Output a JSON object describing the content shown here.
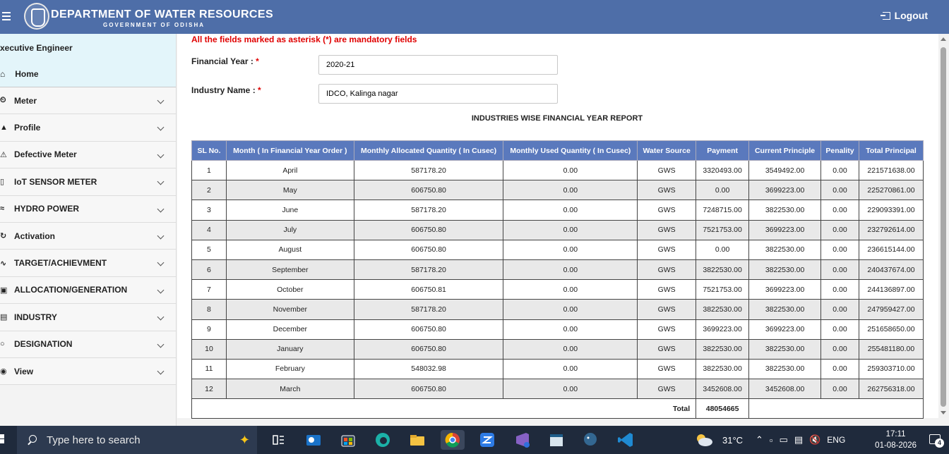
{
  "header": {
    "title": "DEPARTMENT OF WATER RESOURCES",
    "subtitle": "GOVERNMENT OF ODISHA",
    "logout_label": "Logout"
  },
  "sidebar": {
    "role": "xecutive Engineer",
    "home_label": "Home",
    "items": [
      {
        "label": "Meter",
        "icon": "gauge-icon"
      },
      {
        "label": "Profile",
        "icon": "user-icon"
      },
      {
        "label": "Defective Meter",
        "icon": "warning-icon"
      },
      {
        "label": "IoT SENSOR METER",
        "icon": "sensor-icon"
      },
      {
        "label": "HYDRO POWER",
        "icon": "water-icon"
      },
      {
        "label": "Activation",
        "icon": "refresh-icon"
      },
      {
        "label": "TARGET/ACHIEVMENT",
        "icon": "trend-icon"
      },
      {
        "label": "ALLOCATION/GENERATION",
        "icon": "allocation-icon"
      },
      {
        "label": "INDUSTRY",
        "icon": "industry-icon"
      },
      {
        "label": "DESIGNATION",
        "icon": "person-icon"
      },
      {
        "label": "View",
        "icon": "eye-icon"
      }
    ]
  },
  "form": {
    "mandatory_note": "All the fields marked as asterisk (*) are mandatory fields",
    "financial_year_label": "Financial Year :",
    "financial_year_value": "2020-21",
    "industry_label": "Industry Name :",
    "industry_value": "IDCO, Kalinga nagar",
    "asterisk": "*"
  },
  "report": {
    "title": "INDUSTRIES WISE FINANCIAL YEAR REPORT",
    "columns": [
      "SL No.",
      "Month ( In Financial Year Order )",
      "Monthly Allocated Quantity ( In Cusec)",
      "Monthly Used Quantity ( In Cusec)",
      "Water Source",
      "Payment",
      "Current Principle",
      "Penality",
      "Total Principal"
    ],
    "rows": [
      [
        "1",
        "April",
        "587178.20",
        "0.00",
        "GWS",
        "3320493.00",
        "3549492.00",
        "0.00",
        "221571638.00"
      ],
      [
        "2",
        "May",
        "606750.80",
        "0.00",
        "GWS",
        "0.00",
        "3699223.00",
        "0.00",
        "225270861.00"
      ],
      [
        "3",
        "June",
        "587178.20",
        "0.00",
        "GWS",
        "7248715.00",
        "3822530.00",
        "0.00",
        "229093391.00"
      ],
      [
        "4",
        "July",
        "606750.80",
        "0.00",
        "GWS",
        "7521753.00",
        "3699223.00",
        "0.00",
        "232792614.00"
      ],
      [
        "5",
        "August",
        "606750.80",
        "0.00",
        "GWS",
        "0.00",
        "3822530.00",
        "0.00",
        "236615144.00"
      ],
      [
        "6",
        "September",
        "587178.20",
        "0.00",
        "GWS",
        "3822530.00",
        "3822530.00",
        "0.00",
        "240437674.00"
      ],
      [
        "7",
        "October",
        "606750.81",
        "0.00",
        "GWS",
        "7521753.00",
        "3699223.00",
        "0.00",
        "244136897.00"
      ],
      [
        "8",
        "November",
        "587178.20",
        "0.00",
        "GWS",
        "3822530.00",
        "3822530.00",
        "0.00",
        "247959427.00"
      ],
      [
        "9",
        "December",
        "606750.80",
        "0.00",
        "GWS",
        "3699223.00",
        "3699223.00",
        "0.00",
        "251658650.00"
      ],
      [
        "10",
        "January",
        "606750.80",
        "0.00",
        "GWS",
        "3822530.00",
        "3822530.00",
        "0.00",
        "255481180.00"
      ],
      [
        "11",
        "February",
        "548032.98",
        "0.00",
        "GWS",
        "3822530.00",
        "3822530.00",
        "0.00",
        "259303710.00"
      ],
      [
        "12",
        "March",
        "606750.80",
        "0.00",
        "GWS",
        "3452608.00",
        "3452608.00",
        "0.00",
        "262756318.00"
      ]
    ],
    "total_label": "Total",
    "total_value": "48054665"
  },
  "taskbar": {
    "search_placeholder": "Type here to search",
    "temperature": "31°C",
    "language": "ENG",
    "time": "17:11",
    "date": "01-08-2026",
    "notification_count": "4"
  },
  "colors": {
    "header_bg": "#4e6ea8",
    "table_header_bg": "#5a79bd",
    "mandatory_red": "#e00000",
    "sidebar_highlight": "#e3f5fa",
    "taskbar_bg": "#1f2a3c"
  }
}
